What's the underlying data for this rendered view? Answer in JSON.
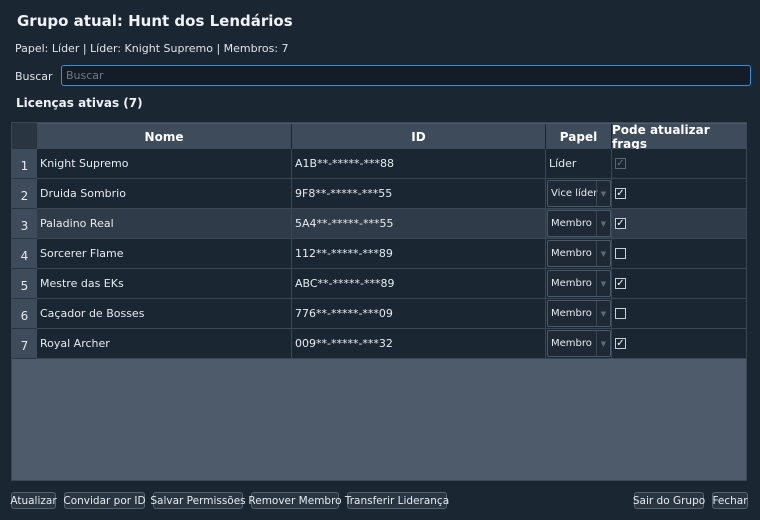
{
  "header": {
    "title": "Grupo atual: Hunt dos Lendários",
    "info": "Papel: Líder | Líder: Knight Supremo | Membros: 7"
  },
  "search": {
    "label": "Buscar",
    "placeholder": "Buscar",
    "value": ""
  },
  "licenses": {
    "heading": "Licenças ativas (7)",
    "columns": [
      "Nome",
      "ID",
      "Papel",
      "Pode atualizar frags"
    ],
    "rows": [
      {
        "num": "1",
        "name": "Knight Supremo",
        "id": "A1B**-*****-***88",
        "role": "Líder",
        "role_editable": false,
        "can_update": true,
        "can_update_enabled": false
      },
      {
        "num": "2",
        "name": "Druida Sombrio",
        "id": "9F8**-*****-***55",
        "role": "Vice líder",
        "role_editable": true,
        "can_update": true,
        "can_update_enabled": true
      },
      {
        "num": "3",
        "name": "Paladino Real",
        "id": "5A4**-*****-***55",
        "role": "Membro",
        "role_editable": true,
        "can_update": true,
        "can_update_enabled": true
      },
      {
        "num": "4",
        "name": "Sorcerer Flame",
        "id": "112**-*****-***89",
        "role": "Membro",
        "role_editable": true,
        "can_update": false,
        "can_update_enabled": true
      },
      {
        "num": "5",
        "name": "Mestre das EKs",
        "id": "ABC**-*****-***89",
        "role": "Membro",
        "role_editable": true,
        "can_update": true,
        "can_update_enabled": true
      },
      {
        "num": "6",
        "name": "Caçador de Bosses",
        "id": "776**-*****-***09",
        "role": "Membro",
        "role_editable": true,
        "can_update": false,
        "can_update_enabled": true
      },
      {
        "num": "7",
        "name": "Royal Archer",
        "id": "009**-*****-***32",
        "role": "Membro",
        "role_editable": true,
        "can_update": true,
        "can_update_enabled": true
      }
    ],
    "selected_row": 3
  },
  "footer": {
    "refresh": "Atualizar",
    "invite": "Convidar por ID",
    "save_permissions": "Salvar Permissões",
    "remove_member": "Remover Membro",
    "transfer_leadership": "Transferir Liderança",
    "leave_group": "Sair do Grupo",
    "close": "Fechar"
  },
  "colors": {
    "background": "#1b2633",
    "header": "#3d4b5b",
    "accent": "#3a8fd6"
  }
}
